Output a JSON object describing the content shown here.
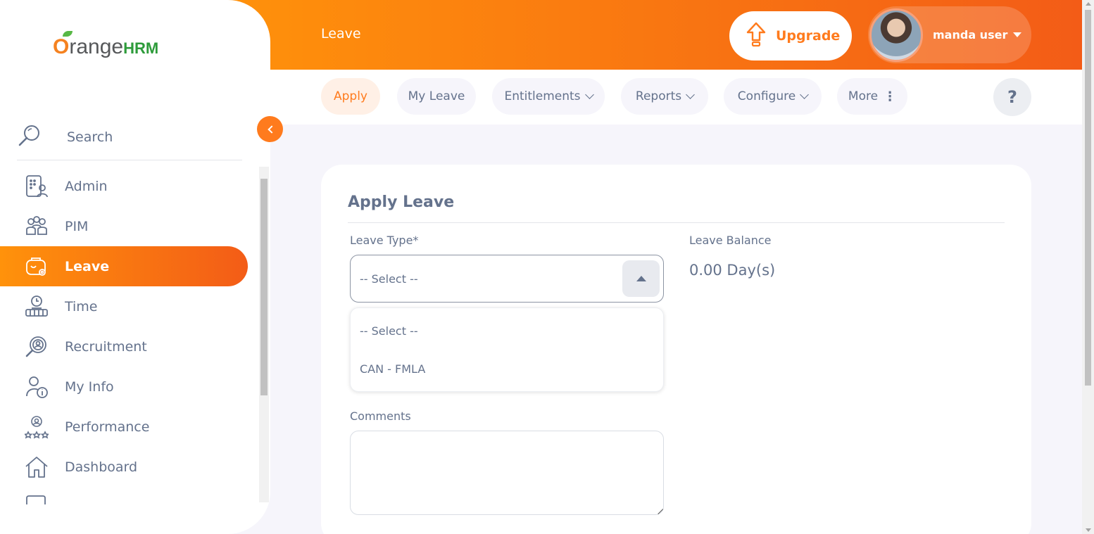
{
  "header": {
    "title": "Leave",
    "upgrade_label": "Upgrade",
    "user_name": "manda user"
  },
  "nav": {
    "tabs": [
      {
        "label": "Apply"
      },
      {
        "label": "My Leave"
      },
      {
        "label": "Entitlements"
      },
      {
        "label": "Reports"
      },
      {
        "label": "Configure"
      },
      {
        "label": "More"
      }
    ],
    "help_label": "?"
  },
  "sidebar": {
    "logo_o": "O",
    "logo_range": "range",
    "logo_hrm": "HRM",
    "search_label": "Search",
    "items": [
      {
        "label": "Admin"
      },
      {
        "label": "PIM"
      },
      {
        "label": "Leave"
      },
      {
        "label": "Time"
      },
      {
        "label": "Recruitment"
      },
      {
        "label": "My Info"
      },
      {
        "label": "Performance"
      },
      {
        "label": "Dashboard"
      }
    ]
  },
  "form": {
    "title": "Apply Leave",
    "leave_type_label": "Leave Type*",
    "leave_type_value": "-- Select --",
    "options": [
      "-- Select --",
      "CAN - FMLA"
    ],
    "leave_balance_label": "Leave Balance",
    "leave_balance_value": "0.00 Day(s)",
    "comments_label": "Comments"
  },
  "colors": {
    "accent": "#ff7b1d",
    "gradient_start": "#ff920b",
    "gradient_end": "#f35c17",
    "text": "#64728c"
  }
}
